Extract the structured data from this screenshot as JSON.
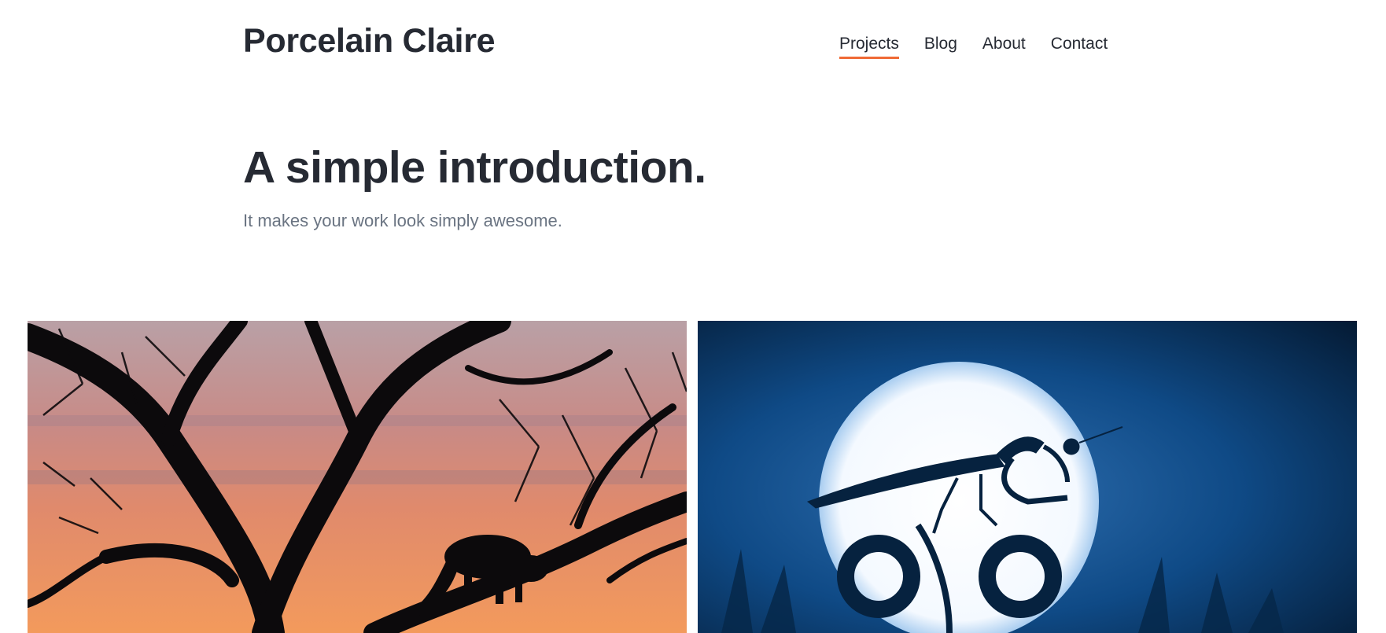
{
  "header": {
    "site_title": "Porcelain Claire",
    "nav": [
      {
        "label": "Projects",
        "active": true
      },
      {
        "label": "Blog",
        "active": false
      },
      {
        "label": "About",
        "active": false
      },
      {
        "label": "Contact",
        "active": false
      }
    ]
  },
  "hero": {
    "title": "A simple introduction.",
    "subtitle": "It makes your work look simply awesome."
  },
  "gallery": {
    "items": [
      {
        "image": "leopard-in-tree-at-sunset"
      },
      {
        "image": "praying-mantis-on-flower-against-moon"
      }
    ]
  },
  "colors": {
    "accent": "#f06a35",
    "text": "#262a33",
    "muted": "#6a7482"
  }
}
